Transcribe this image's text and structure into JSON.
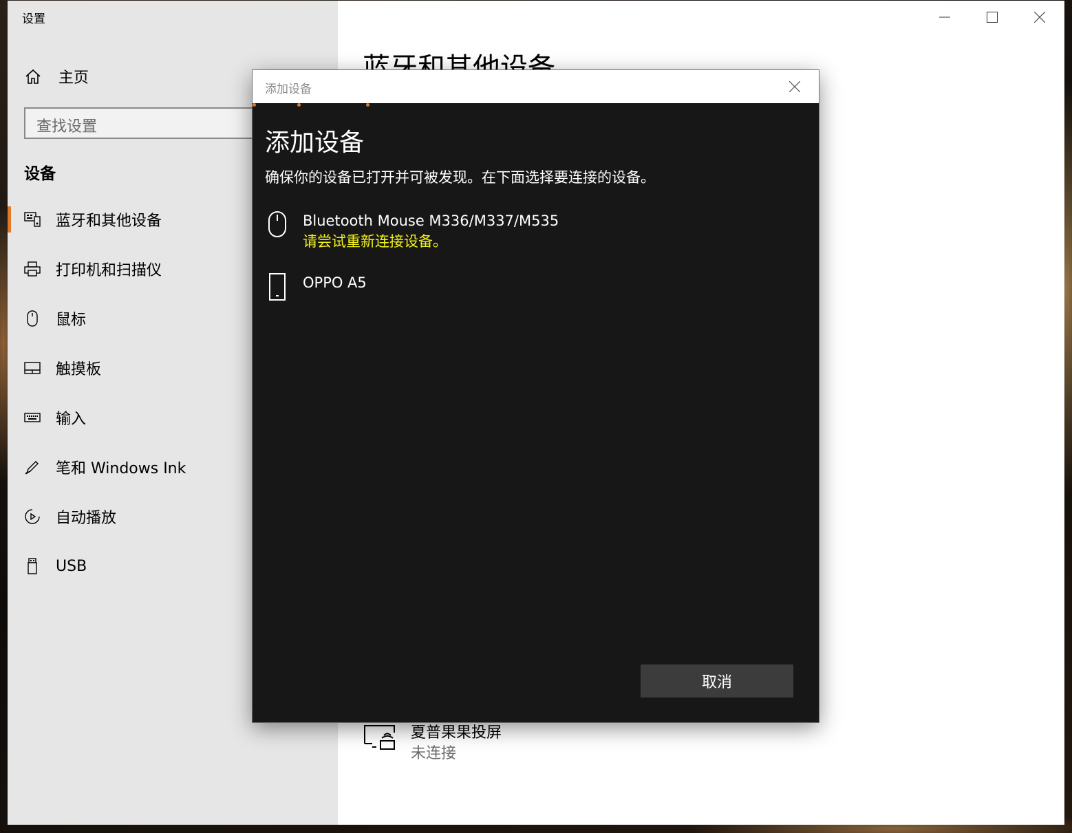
{
  "window": {
    "title": "设置",
    "home_label": "主页",
    "search_placeholder": "查找设置",
    "section_title": "设备",
    "nav": [
      {
        "label": "蓝牙和其他设备",
        "icon": "bluetooth-devices-icon",
        "selected": true
      },
      {
        "label": "打印机和扫描仪",
        "icon": "printer-icon",
        "selected": false
      },
      {
        "label": "鼠标",
        "icon": "mouse-icon",
        "selected": false
      },
      {
        "label": "触摸板",
        "icon": "touchpad-icon",
        "selected": false
      },
      {
        "label": "输入",
        "icon": "keyboard-icon",
        "selected": false
      },
      {
        "label": "笔和 Windows Ink",
        "icon": "pen-icon",
        "selected": false
      },
      {
        "label": "自动播放",
        "icon": "autoplay-icon",
        "selected": false
      },
      {
        "label": "USB",
        "icon": "usb-icon",
        "selected": false
      }
    ],
    "main_heading": "蓝牙和其他设备",
    "cast_device": {
      "name": "夏普果果投屏",
      "status": "未连接",
      "icon": "cast-display-icon"
    }
  },
  "dialog": {
    "title": "添加设备",
    "heading": "添加设备",
    "subtitle": "确保你的设备已打开并可被发现。在下面选择要连接的设备。",
    "devices": [
      {
        "name": "Bluetooth Mouse M336/M337/M535",
        "status": "请尝试重新连接设备。",
        "icon": "mouse-icon"
      },
      {
        "name": "OPPO A5",
        "status": "",
        "icon": "phone-icon"
      }
    ],
    "cancel_label": "取消"
  },
  "colors": {
    "accent": "#e07a28",
    "dialog_bg": "#171717",
    "warning_text": "#f2f21b",
    "sidebar_bg": "#e6e6e6"
  }
}
